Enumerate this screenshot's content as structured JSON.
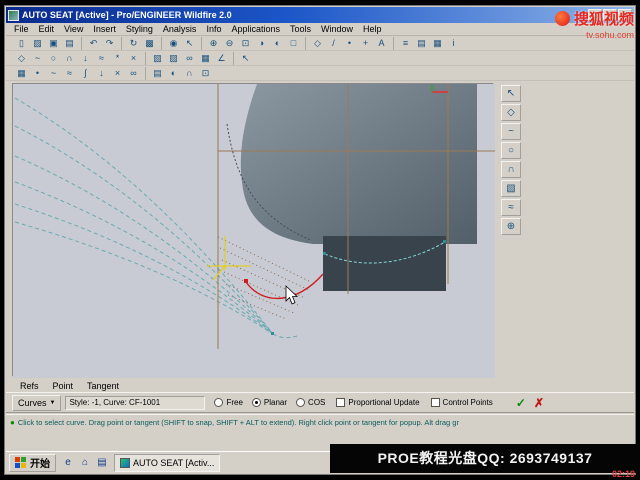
{
  "window": {
    "title": "AUTO  SEAT [Active] - Pro/ENGINEER Wildfire 2.0",
    "minimize_glyph": "_",
    "maximize_glyph": "□",
    "close_glyph": "×"
  },
  "menu": {
    "items": [
      {
        "n": "menu-file",
        "t": "File"
      },
      {
        "n": "menu-edit",
        "t": "Edit"
      },
      {
        "n": "menu-view",
        "t": "View"
      },
      {
        "n": "menu-insert",
        "t": "Insert"
      },
      {
        "n": "menu-styling",
        "t": "Styling"
      },
      {
        "n": "menu-analysis",
        "t": "Analysis"
      },
      {
        "n": "menu-info",
        "t": "Info"
      },
      {
        "n": "menu-applications",
        "t": "Applications"
      },
      {
        "n": "menu-tools",
        "t": "Tools"
      },
      {
        "n": "menu-window",
        "t": "Window"
      },
      {
        "n": "menu-help",
        "t": "Help"
      }
    ]
  },
  "toolbars": {
    "row1a": [
      {
        "n": "new-file-icon",
        "g": "▯"
      },
      {
        "n": "open-file-icon",
        "g": "▨"
      },
      {
        "n": "save-icon",
        "g": "▣"
      },
      {
        "n": "print-icon",
        "g": "▤"
      }
    ],
    "row1b": [
      {
        "n": "undo-icon",
        "g": "↶"
      },
      {
        "n": "redo-icon",
        "g": "↷"
      }
    ],
    "row1c": [
      {
        "n": "regenerate-icon",
        "g": "↻"
      },
      {
        "n": "repaint-icon",
        "g": "▩"
      }
    ],
    "row1d": [
      {
        "n": "search-icon",
        "g": "◉"
      },
      {
        "n": "select-icon",
        "g": "↖"
      }
    ],
    "row1e": [
      {
        "n": "zoom-in-icon",
        "g": "⊕"
      },
      {
        "n": "zoom-out-icon",
        "g": "⊖"
      },
      {
        "n": "refit-icon",
        "g": "⊡"
      },
      {
        "n": "orient-icon",
        "g": "◑"
      },
      {
        "n": "shade-icon",
        "g": "◐"
      },
      {
        "n": "wireframe-icon",
        "g": "□"
      }
    ],
    "row1f": [
      {
        "n": "datum-plane-icon",
        "g": "◇"
      },
      {
        "n": "datum-axis-icon",
        "g": "/"
      },
      {
        "n": "datum-point-icon",
        "g": "•"
      },
      {
        "n": "csys-icon",
        "g": "+"
      },
      {
        "n": "annotation-icon",
        "g": "A"
      }
    ],
    "row1g": [
      {
        "n": "model-tree-icon",
        "g": "≡"
      },
      {
        "n": "layers-icon",
        "g": "▤"
      },
      {
        "n": "view-manager-icon",
        "g": "▦"
      },
      {
        "n": "info-icon",
        "g": "i"
      }
    ],
    "row2a": [
      {
        "n": "set-active-plane-icon",
        "g": "◇"
      },
      {
        "n": "style-curve-icon",
        "g": "~"
      },
      {
        "n": "style-circle-icon",
        "g": "○"
      },
      {
        "n": "style-arc-icon",
        "g": "∩"
      },
      {
        "n": "drop-curve-icon",
        "g": "↓"
      },
      {
        "n": "offset-curve-icon",
        "g": "≈"
      },
      {
        "n": "edit-curve-icon",
        "g": "*"
      },
      {
        "n": "trim-curve-icon",
        "g": "×"
      }
    ],
    "row2b": [
      {
        "n": "surface-icon",
        "g": "▧"
      },
      {
        "n": "surface-trim-icon",
        "g": "▨"
      },
      {
        "n": "surface-connect-icon",
        "g": "∞"
      },
      {
        "n": "mesh-icon",
        "g": "▦"
      },
      {
        "n": "analysis-angle-icon",
        "g": "∠"
      }
    ],
    "row2c": [
      {
        "n": "pointer-icon",
        "g": "↖"
      }
    ],
    "row3a": [
      {
        "n": "grid-toggle-icon",
        "g": "▦"
      },
      {
        "n": "style-point-icon",
        "g": "•"
      },
      {
        "n": "planar-curve-icon",
        "g": "~"
      },
      {
        "n": "free-curve-icon",
        "g": "≈"
      },
      {
        "n": "cos-curve-icon",
        "g": "∫"
      },
      {
        "n": "drop-point-icon",
        "g": "↓"
      },
      {
        "n": "curve-trim-icon",
        "g": "×"
      },
      {
        "n": "curve-connect-icon",
        "g": "∞"
      }
    ],
    "row3b": [
      {
        "n": "show-mesh-icon",
        "g": "▤"
      },
      {
        "n": "shade-preview-icon",
        "g": "◐"
      },
      {
        "n": "curvature-plot-icon",
        "g": "∩"
      },
      {
        "n": "refit-view-icon",
        "g": "⊡"
      }
    ],
    "right": [
      {
        "n": "select-arrow-icon",
        "g": "↖"
      },
      {
        "n": "active-plane-icon",
        "g": "◇"
      },
      {
        "n": "create-curve-icon",
        "g": "~"
      },
      {
        "n": "create-circle-icon",
        "g": "○"
      },
      {
        "n": "create-arc-icon",
        "g": "∩"
      },
      {
        "n": "create-surface-icon",
        "g": "▧"
      },
      {
        "n": "connect-icon",
        "g": "≈"
      },
      {
        "n": "analysis-icon",
        "g": "⊕"
      }
    ]
  },
  "refs_menu": {
    "items": [
      {
        "n": "refs-menu-item",
        "t": "Refs"
      },
      {
        "n": "point-menu-item",
        "t": "Point"
      },
      {
        "n": "tangent-menu-item",
        "t": "Tangent"
      }
    ]
  },
  "edit_bar": {
    "curves_label": "Curves",
    "dropdown_glyph": "▼",
    "style_field": "Style: -1, Curve:  CF-1001",
    "radios": [
      {
        "n": "radio-free",
        "t": "Free",
        "on": false
      },
      {
        "n": "radio-planar",
        "t": "Planar",
        "on": true
      },
      {
        "n": "radio-cos",
        "t": "COS",
        "on": false
      }
    ],
    "checkboxes": [
      {
        "n": "checkbox-proportional-update",
        "t": "Proportional Update",
        "on": false
      },
      {
        "n": "checkbox-control-points",
        "t": "Control Points",
        "on": false
      }
    ],
    "accept_glyph": "✓",
    "cancel_glyph": "✗"
  },
  "status_bar": {
    "bullet": "●",
    "message": "Click to select curve. Drag point or tangent (SHIFT to snap, SHIFT + ALT to extend). Right click point or tangent for popup. Alt drag gr"
  },
  "taskbar": {
    "start_label": "开始",
    "quick_icons": [
      {
        "n": "quick-launch-browser-icon",
        "g": "e"
      },
      {
        "n": "quick-launch-desktop-icon",
        "g": "⌂"
      },
      {
        "n": "quick-launch-folder-icon",
        "g": "▤"
      }
    ],
    "task_button_label": "AUTO  SEAT [Activ..."
  },
  "overlay": {
    "text": "PROE教程光盘QQ: 2693749137",
    "time": "02:19"
  },
  "watermark": {
    "title": "搜狐视频",
    "subtitle": "tv.sohu.com"
  }
}
